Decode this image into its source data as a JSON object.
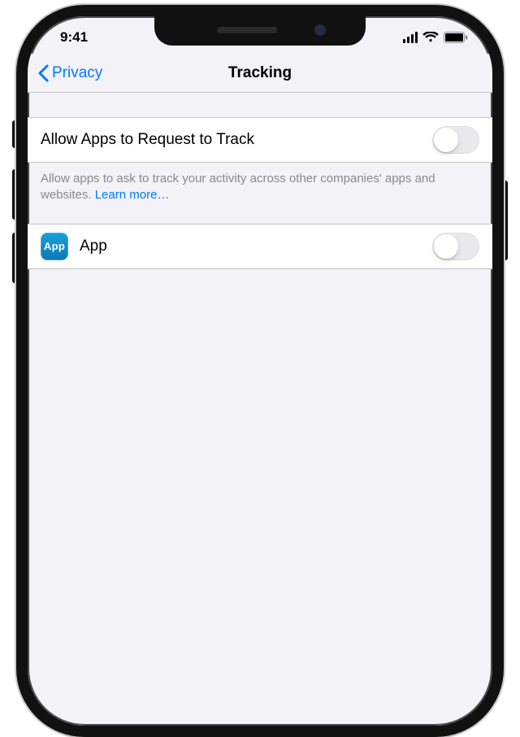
{
  "statusbar": {
    "time": "9:41"
  },
  "navbar": {
    "back_label": "Privacy",
    "title": "Tracking"
  },
  "sections": {
    "allow_tracking": {
      "label": "Allow Apps to Request to Track",
      "toggle_on": false,
      "footer_text": "Allow apps to ask to track your activity across other companies' apps and websites. ",
      "learn_more_label": "Learn more…"
    },
    "apps": [
      {
        "icon_text": "App",
        "name": "App",
        "toggle_on": false
      }
    ]
  },
  "colors": {
    "accent": "#007aff"
  }
}
